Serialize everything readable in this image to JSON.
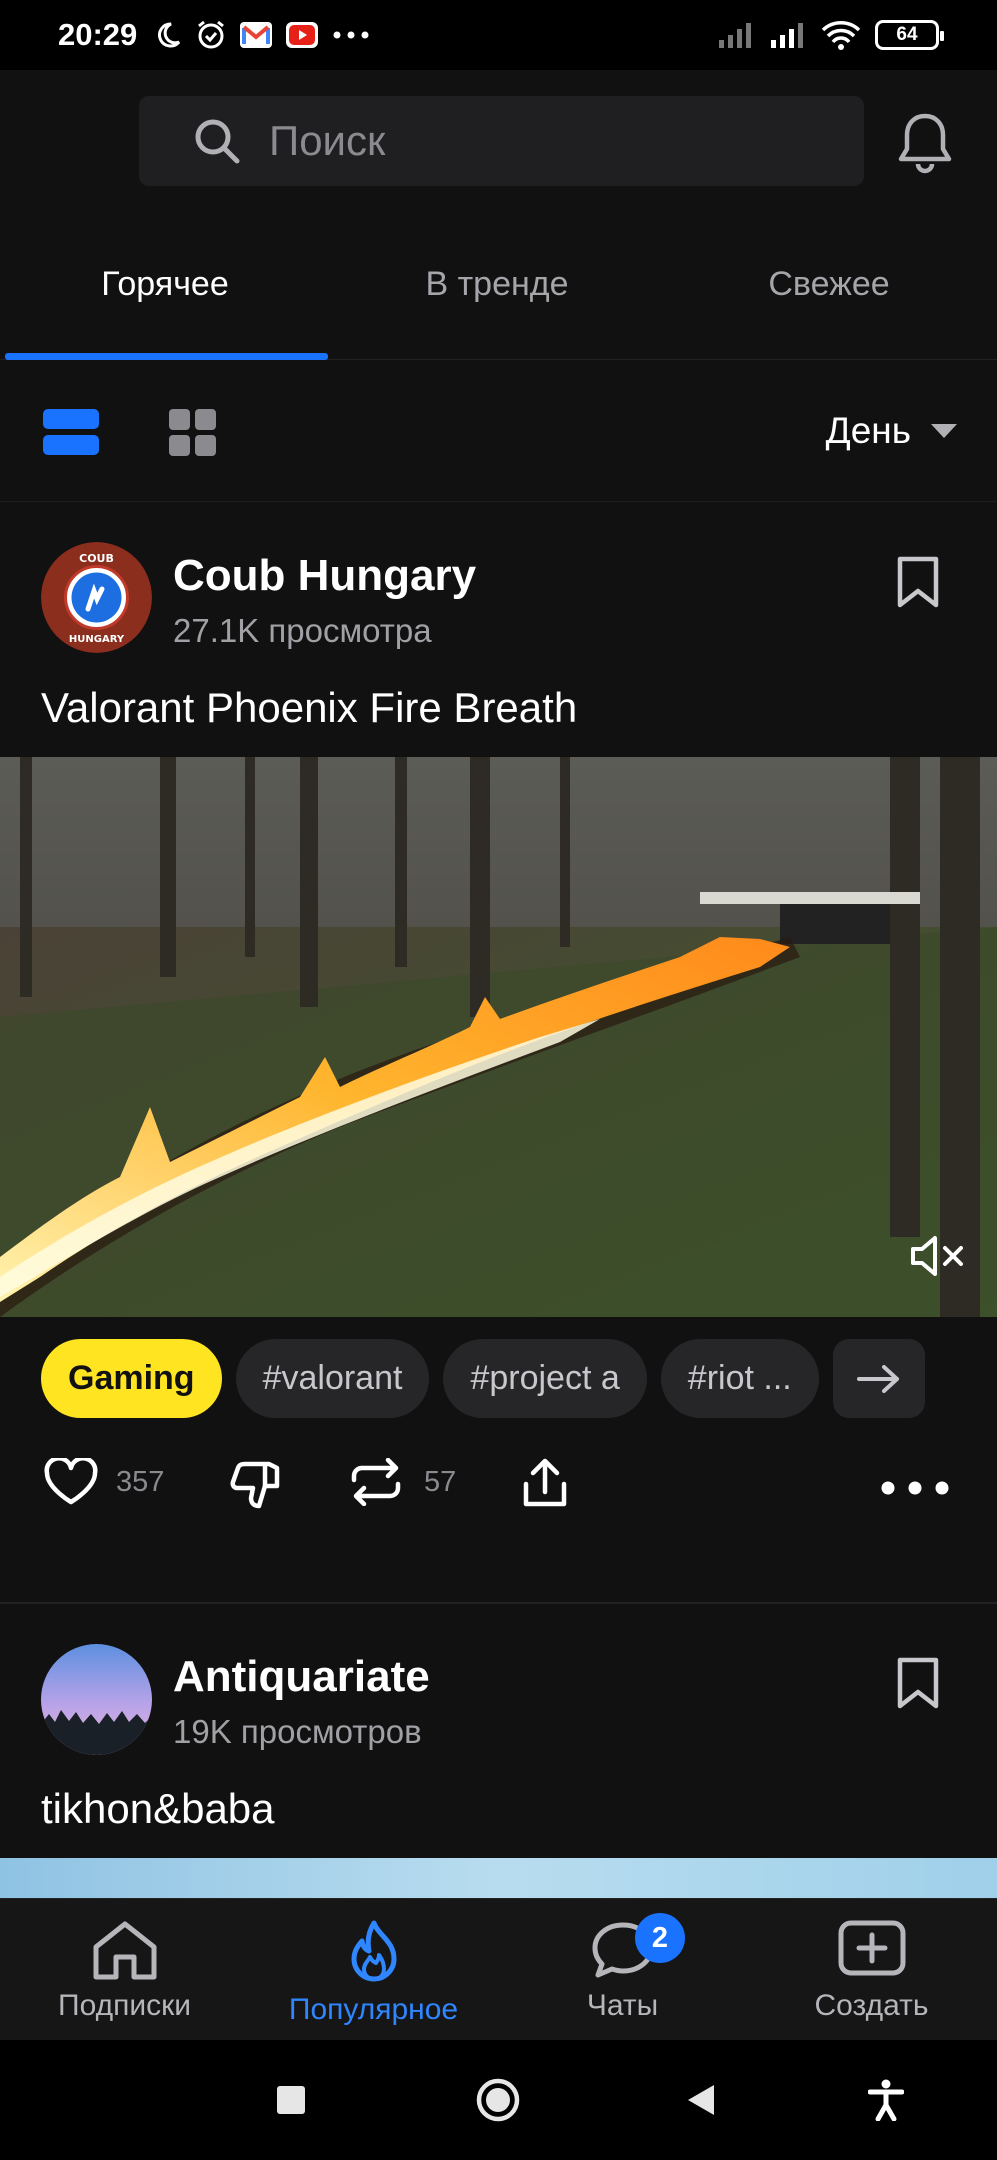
{
  "status_bar": {
    "time": "20:29",
    "battery": "64",
    "icons_left": [
      "moon-icon",
      "alarm-icon",
      "gmail-icon",
      "youtube-icon",
      "more-dots-icon"
    ],
    "icons_right": [
      "signal-icon",
      "signal-icon",
      "wifi-icon",
      "battery-icon"
    ]
  },
  "header": {
    "search_placeholder": "Поиск"
  },
  "tabs": [
    {
      "label": "Горячее",
      "active": true
    },
    {
      "label": "В тренде",
      "active": false
    },
    {
      "label": "Свежее",
      "active": false
    }
  ],
  "view_bar": {
    "period": "День"
  },
  "posts": [
    {
      "author": "Coub Hungary",
      "views": "27.1K просмотра",
      "title": "Valorant Phoenix Fire Breath",
      "avatar_text_top": "COUB",
      "avatar_text_bottom": "HUNGARY",
      "tags": [
        "Gaming",
        "#valorant",
        "#project a",
        "#riot ..."
      ],
      "likes": "357",
      "recoubs": "57"
    },
    {
      "author": "Antiquariate",
      "views": "19K просмотров",
      "title": "tikhon&baba"
    }
  ],
  "bottom_nav": [
    {
      "label": "Подписки",
      "icon": "home-icon",
      "active": false
    },
    {
      "label": "Популярное",
      "icon": "flame-icon",
      "active": true
    },
    {
      "label": "Чаты",
      "icon": "chat-icon",
      "active": false,
      "badge": "2"
    },
    {
      "label": "Создать",
      "icon": "create-icon",
      "active": false
    }
  ],
  "colors": {
    "accent": "#1a73ff",
    "tag_highlight": "#ffe422",
    "background": "#111112"
  }
}
